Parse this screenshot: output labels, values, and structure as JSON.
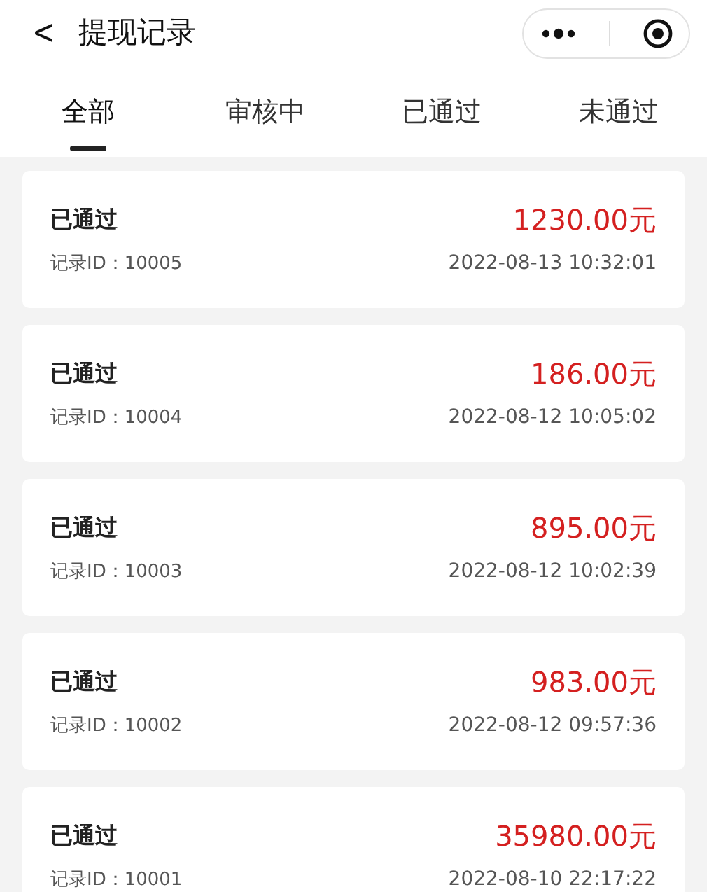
{
  "header": {
    "back": "<",
    "title": "提现记录"
  },
  "tabs": [
    {
      "label": "全部",
      "selected": true
    },
    {
      "label": "审核中",
      "selected": false
    },
    {
      "label": "已通过",
      "selected": false
    },
    {
      "label": "未通过",
      "selected": false
    }
  ],
  "records": [
    {
      "status": "已通过",
      "record_id": "记录ID：10005",
      "amount": "1230.00元",
      "time": "2022-08-13 10:32:01"
    },
    {
      "status": "已通过",
      "record_id": "记录ID：10004",
      "amount": "186.00元",
      "time": "2022-08-12 10:05:02"
    },
    {
      "status": "已通过",
      "record_id": "记录ID：10003",
      "amount": "895.00元",
      "time": "2022-08-12 10:02:39"
    },
    {
      "status": "已通过",
      "record_id": "记录ID：10002",
      "amount": "983.00元",
      "time": "2022-08-12 09:57:36"
    },
    {
      "status": "已通过",
      "record_id": "记录ID：10001",
      "amount": "35980.00元",
      "time": "2022-08-10 22:17:22"
    }
  ]
}
